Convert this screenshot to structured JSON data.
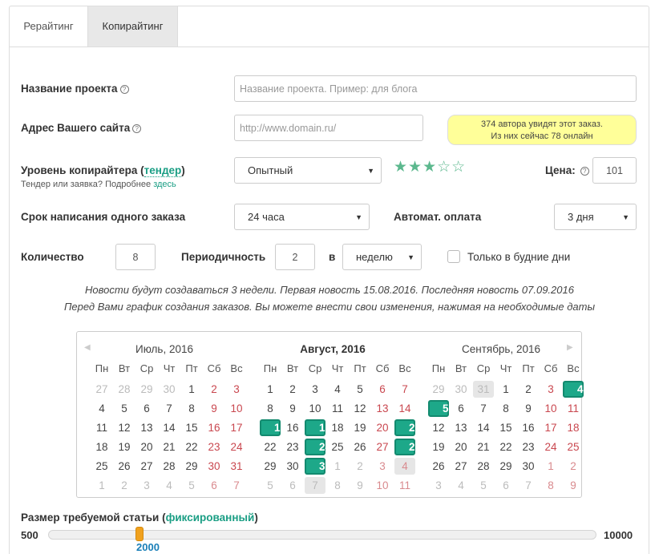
{
  "tabs": [
    {
      "label": "Рерайтинг"
    },
    {
      "label": "Копирайтинг"
    }
  ],
  "form": {
    "project_name": {
      "label": "Название проекта",
      "placeholder": "Название проекта. Пример: для блога"
    },
    "site": {
      "label": "Адрес Вашего сайта",
      "placeholder": "http://www.domain.ru/"
    },
    "authors_note": {
      "line1": "374 автора увидят этот заказ.",
      "line2": "Из них сейчас 78 онлайн"
    },
    "level": {
      "label_pre": "Уровень копирайтера (",
      "label_link": "тендер",
      "label_post": ")",
      "hint_pre": "Тендер или заявка? Подробнее ",
      "hint_link": "здесь",
      "value": "Опытный",
      "stars": "★★★☆☆",
      "rating": 3
    },
    "price": {
      "label": "Цена:",
      "value": "101"
    },
    "deadline": {
      "label": "Срок написания одного заказа",
      "value": "24 часа"
    },
    "autopay": {
      "label": "Автомат. оплата",
      "value": "3 дня"
    },
    "quantity": {
      "label": "Количество",
      "value": "8"
    },
    "periodicity": {
      "label": "Периодичность",
      "value": "2",
      "in_label": "в",
      "unit": "неделю"
    },
    "weekdays_only": {
      "label": "Только в будние дни",
      "checked": false
    },
    "info_line1": "Новости будут создаваться 3 недели. Первая новость 15.08.2016. Последняя новость 07.09.2016",
    "info_line2": "Перед Вами график создания заказов. Вы можете внести свои изменения, нажимая на необходимые даты",
    "size": {
      "label_pre": "Размер требуемой статьи (",
      "label_link": "фиксированный",
      "label_post": ")",
      "min": "500",
      "max": "10000",
      "value": "2000"
    }
  },
  "calendar": {
    "weekdays": [
      "Пн",
      "Вт",
      "Ср",
      "Чт",
      "Пт",
      "Сб",
      "Вс"
    ],
    "months": [
      {
        "title": "Июль, 2016",
        "bold": false,
        "days": [
          "27",
          "28",
          "29",
          "30",
          "1",
          "2",
          "3",
          "4",
          "5",
          "6",
          "7",
          "8",
          "9",
          "10",
          "11",
          "12",
          "13",
          "14",
          "15",
          "16",
          "17",
          "18",
          "19",
          "20",
          "21",
          "22",
          "23",
          "24",
          "25",
          "26",
          "27",
          "28",
          "29",
          "30",
          "31",
          "1",
          "2",
          "3",
          "4",
          "5",
          "6",
          "7"
        ],
        "other": [
          0,
          1,
          2,
          3,
          35,
          36,
          37,
          38,
          39,
          40,
          41
        ],
        "selected": [],
        "grey": []
      },
      {
        "title": "Август, 2016",
        "bold": true,
        "days": [
          "1",
          "2",
          "3",
          "4",
          "5",
          "6",
          "7",
          "8",
          "9",
          "10",
          "11",
          "12",
          "13",
          "14",
          "15",
          "16",
          "17",
          "18",
          "19",
          "20",
          "21",
          "22",
          "23",
          "24",
          "25",
          "26",
          "27",
          "28",
          "29",
          "30",
          "31",
          "1",
          "2",
          "3",
          "4",
          "5",
          "6",
          "7",
          "8",
          "9",
          "10",
          "11"
        ],
        "other": [
          31,
          32,
          33,
          34,
          35,
          36,
          37,
          38,
          39,
          40,
          41
        ],
        "selected": [
          14,
          16,
          20,
          23,
          27,
          30
        ],
        "grey": [
          34,
          37
        ]
      },
      {
        "title": "Сентябрь, 2016",
        "bold": false,
        "days": [
          "29",
          "30",
          "31",
          "1",
          "2",
          "3",
          "4",
          "5",
          "6",
          "7",
          "8",
          "9",
          "10",
          "11",
          "12",
          "13",
          "14",
          "15",
          "16",
          "17",
          "18",
          "19",
          "20",
          "21",
          "22",
          "23",
          "24",
          "25",
          "26",
          "27",
          "28",
          "29",
          "30",
          "1",
          "2",
          "3",
          "4",
          "5",
          "6",
          "7",
          "8",
          "9"
        ],
        "other": [
          0,
          1,
          2,
          33,
          34,
          35,
          36,
          37,
          38,
          39,
          40,
          41
        ],
        "selected": [
          6,
          7
        ],
        "grey": [
          2
        ]
      }
    ]
  },
  "colors": {
    "accent": "#1da889",
    "link": "#1a9e84",
    "weekend": "#c9474f",
    "handle": "#f0a11e",
    "note_bg": "#ffff99"
  }
}
